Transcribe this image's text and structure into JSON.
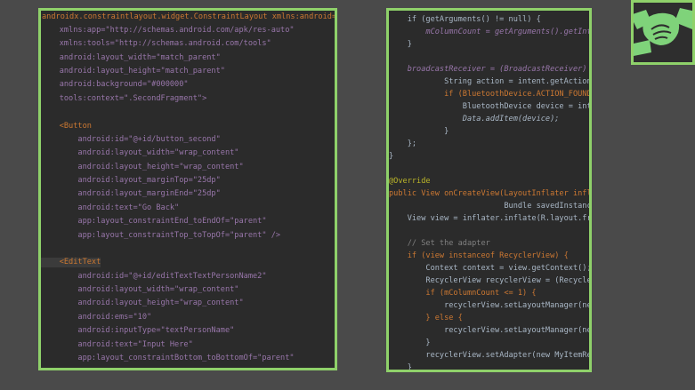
{
  "left_code": {
    "lines": [
      "androidx.constraintlayout.widget.ConstraintLayout xmlns:android=\"",
      "    xmlns:app=\"http://schemas.android.com/apk/res-auto\"",
      "    xmlns:tools=\"http://schemas.android.com/tools\"",
      "    android:layout_width=\"match_parent\"",
      "    android:layout_height=\"match_parent\"",
      "    android:background=\"#000000\"",
      "    tools:context=\".SecondFragment\">",
      "",
      "    <Button",
      "        android:id=\"@+id/button_second\"",
      "        android:layout_width=\"wrap_content\"",
      "        android:layout_height=\"wrap_content\"",
      "        android:layout_marginTop=\"25dp\"",
      "        android:layout_marginEnd=\"25dp\"",
      "        android:text=\"Go Back\"",
      "        app:layout_constraintEnd_toEndOf=\"parent\"",
      "        app:layout_constraintTop_toTopOf=\"parent\" />",
      "",
      "    <EditText",
      "        android:id=\"@+id/editTextTextPersonName2\"",
      "        android:layout_width=\"wrap_content\"",
      "        android:layout_height=\"wrap_content\"",
      "        android:ems=\"10\"",
      "        android:inputType=\"textPersonName\"",
      "        android:text=\"Input Here\"",
      "        app:layout_constraintBottom_toBottomOf=\"parent\""
    ]
  },
  "right_code": {
    "lines": [
      "    if (getArguments() != null) {",
      "        mColumnCount = getArguments().getInt(A",
      "    }",
      "",
      "    broadcastReceiver = (BroadcastReceiver) (c",
      "            String action = intent.getAction()",
      "            if (BluetoothDevice.ACTION_FOUND.e",
      "                BluetoothDevice device = intent",
      "                Data.addItem(device);",
      "            }",
      "    };",
      "}",
      "",
      "@Override",
      "public View onCreateView(LayoutInflater inflate",
      "                         Bundle savedInstanceS",
      "    View view = inflater.inflate(R.layout.frag",
      "",
      "    // Set the adapter",
      "    if (view instanceof RecyclerView) {",
      "        Context context = view.getContext();",
      "        RecyclerView recyclerView = (RecyclerVi",
      "        if (mColumnCount <= 1) {",
      "            recyclerView.setLayoutManager(new",
      "        } else {",
      "            recyclerView.setLayoutManager(new",
      "        }",
      "        recyclerView.setAdapter(new MyItemRecyc",
      "    }"
    ]
  },
  "colors": {
    "accent_border": "#8fd16a",
    "editor_bg": "#2b2b2b",
    "page_bg": "#4a4a4a"
  },
  "logo": {
    "icon": "handshake-icon"
  }
}
